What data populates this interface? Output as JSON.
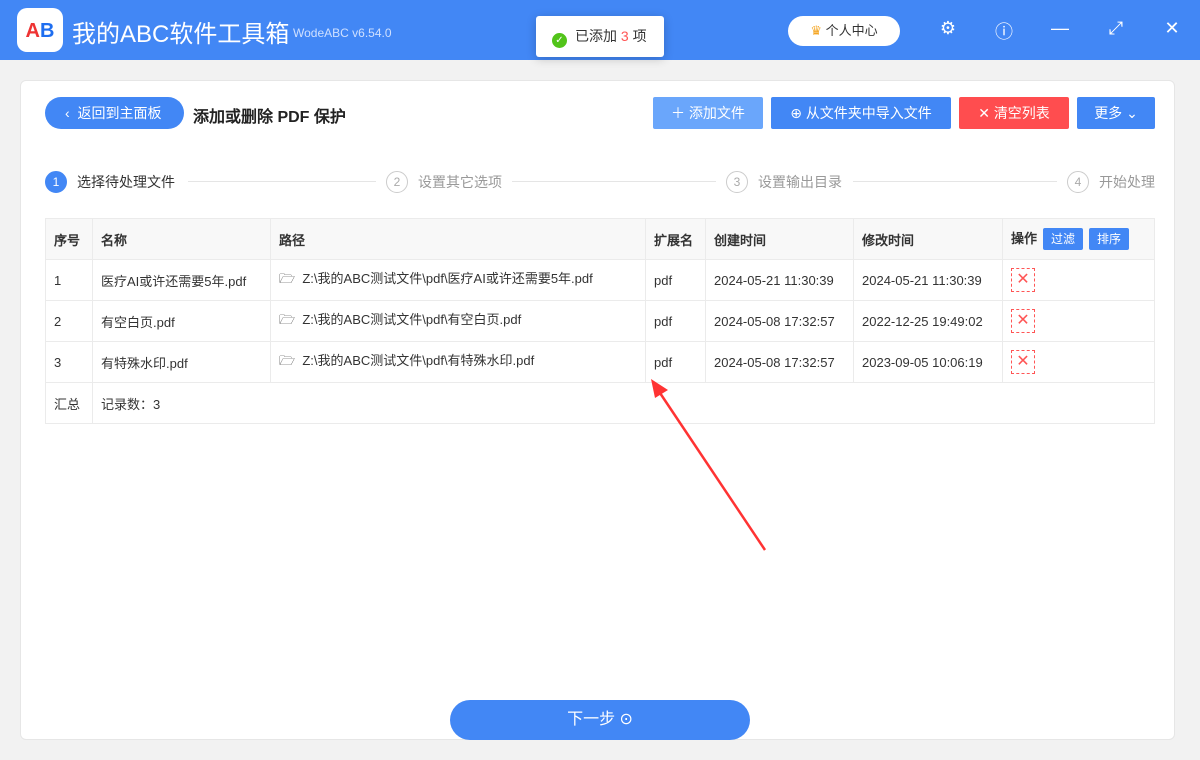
{
  "app": {
    "title": "我的ABC软件工具箱",
    "version": "WodeABC v6.54.0",
    "logo_text": "AB"
  },
  "toast": {
    "prefix": "已添加",
    "count": "3",
    "suffix": "项"
  },
  "header": {
    "user_center": "个人中心"
  },
  "toolbar": {
    "back": "返回到主面板",
    "page_title": "添加或删除 PDF 保护",
    "add_file": "添加文件",
    "import_folder": "从文件夹中导入文件",
    "clear_list": "清空列表",
    "more": "更多"
  },
  "steps": [
    {
      "num": "1",
      "label": "选择待处理文件"
    },
    {
      "num": "2",
      "label": "设置其它选项"
    },
    {
      "num": "3",
      "label": "设置输出目录"
    },
    {
      "num": "4",
      "label": "开始处理"
    }
  ],
  "table": {
    "headers": [
      "序号",
      "名称",
      "路径",
      "扩展名",
      "创建时间",
      "修改时间",
      "操作"
    ],
    "filter": "过滤",
    "sort": "排序",
    "rows": [
      {
        "idx": "1",
        "name": "医疗AI或许还需要5年.pdf",
        "path": "Z:\\我的ABC测试文件\\pdf\\医疗AI或许还需要5年.pdf",
        "ext": "pdf",
        "created": "2024-05-21 11:30:39",
        "modified": "2024-05-21 11:30:39"
      },
      {
        "idx": "2",
        "name": "有空白页.pdf",
        "path": "Z:\\我的ABC测试文件\\pdf\\有空白页.pdf",
        "ext": "pdf",
        "created": "2024-05-08 17:32:57",
        "modified": "2022-12-25 19:49:02"
      },
      {
        "idx": "3",
        "name": "有特殊水印.pdf",
        "path": "Z:\\我的ABC测试文件\\pdf\\有特殊水印.pdf",
        "ext": "pdf",
        "created": "2024-05-08 17:32:57",
        "modified": "2023-09-05 10:06:19"
      }
    ],
    "summary_label": "汇总",
    "summary_value": "记录数：3"
  },
  "footer": {
    "next": "下一步"
  }
}
